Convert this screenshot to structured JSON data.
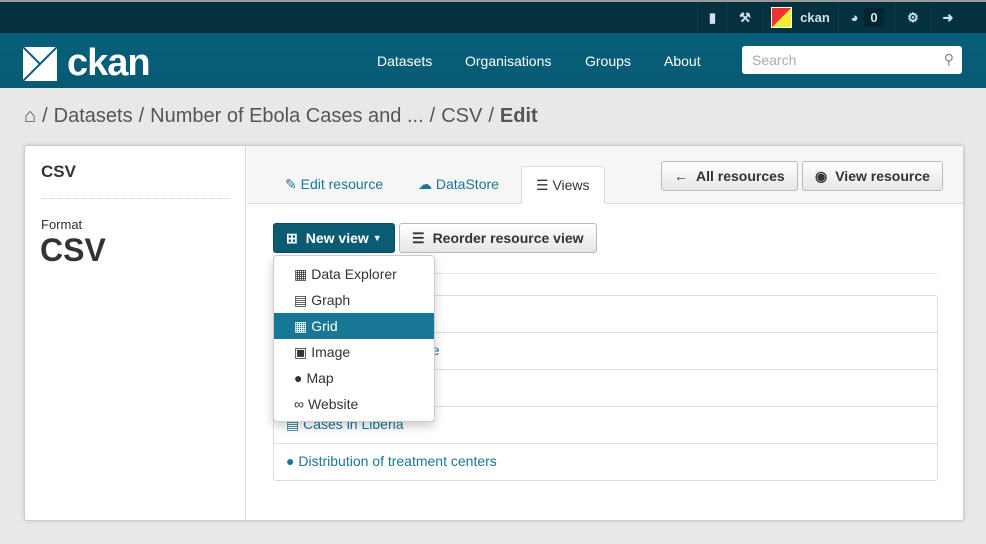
{
  "topbar": {
    "user": "ckan",
    "badge_count": "0",
    "icons": [
      "file-icon",
      "hammer-icon",
      "avatar",
      "dashboard-icon",
      "gear-icon",
      "sign-out-icon"
    ]
  },
  "header": {
    "logo": "ckan",
    "nav": [
      "Datasets",
      "Organisations",
      "Groups",
      "About"
    ],
    "search_placeholder": "Search"
  },
  "breadcrumb": [
    "Datasets",
    "Number of Ebola Cases and ...",
    "CSV",
    "Edit"
  ],
  "sidebar": {
    "title": "CSV",
    "format_label": "Format",
    "format_value": "CSV"
  },
  "tabs": [
    {
      "label": "Edit resource",
      "icon": "edit-icon"
    },
    {
      "label": "DataStore",
      "icon": "cloud-upload-icon"
    },
    {
      "label": "Views",
      "icon": "list-icon",
      "active": true
    }
  ],
  "actions": {
    "all_resources": "All resources",
    "view_resource": "View resource",
    "new_view": "New view",
    "reorder": "Reorder resource view"
  },
  "dropdown": [
    {
      "label": "Data Explorer",
      "icon": "table-icon"
    },
    {
      "label": "Graph",
      "icon": "bar-chart-icon"
    },
    {
      "label": "Grid",
      "icon": "table-icon",
      "highlighted": true
    },
    {
      "label": "Image",
      "icon": "image-icon"
    },
    {
      "label": "Map",
      "icon": "map-marker-icon"
    },
    {
      "label": "Website",
      "icon": "link-icon"
    }
  ],
  "views": {
    "row2_fragment": "ne",
    "row4": "Cases in Liberia",
    "row5": "Distribution of treatment centers"
  },
  "colors": {
    "topbar": "#05303e",
    "header": "#075d77",
    "accent": "#187794",
    "primary_button": "#0b5b73"
  }
}
